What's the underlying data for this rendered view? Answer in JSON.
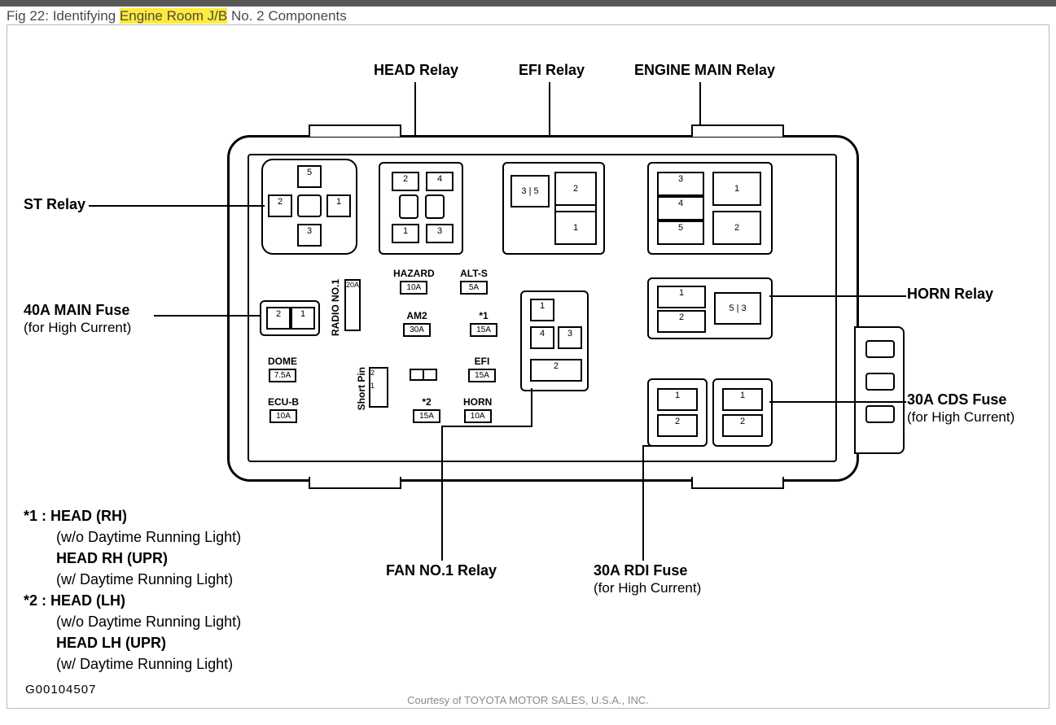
{
  "caption": {
    "prefix": "Fig 22: Identifying",
    "highlight": "Engine Room J/B",
    "suffix": "No. 2 Components"
  },
  "credit": "Courtesy of TOYOTA MOTOR SALES, U.S.A., INC.",
  "id_number": "G00104507",
  "labels": {
    "head_relay": "HEAD Relay",
    "efi_relay": "EFI Relay",
    "engine_main_relay": "ENGINE MAIN Relay",
    "st_relay": "ST Relay",
    "horn_relay": "HORN Relay",
    "main_fuse": "40A MAIN Fuse",
    "main_fuse_sub": "(for High Current)",
    "cds_fuse": "30A CDS Fuse",
    "cds_fuse_sub": "(for High Current)",
    "fan_relay": "FAN NO.1 Relay",
    "rdi_fuse": "30A RDI Fuse",
    "rdi_fuse_sub": "(for High Current)"
  },
  "fuses": {
    "hazard": {
      "name": "HAZARD",
      "amp": "10A"
    },
    "alts": {
      "name": "ALT-S",
      "amp": "5A"
    },
    "am2": {
      "name": "AM2",
      "amp": "30A"
    },
    "star1": {
      "name": "*1",
      "amp": "15A"
    },
    "dome": {
      "name": "DOME",
      "amp": "7.5A"
    },
    "efi": {
      "name": "EFI",
      "amp": "15A"
    },
    "ecub": {
      "name": "ECU-B",
      "amp": "10A"
    },
    "star2": {
      "name": "*2",
      "amp": "15A"
    },
    "horn": {
      "name": "HORN",
      "amp": "10A"
    },
    "radio": {
      "name": "RADIO NO.1",
      "amp": "20A"
    },
    "short": {
      "name": "Short Pin"
    }
  },
  "footnotes": {
    "s1_key": "*1 :",
    "s1_a": "HEAD (RH)",
    "s1_b": "(w/o Daytime Running Light)",
    "s1_c": "HEAD RH (UPR)",
    "s1_d": "(w/ Daytime Running Light)",
    "s2_key": "*2 :",
    "s2_a": "HEAD (LH)",
    "s2_b": "(w/o Daytime Running Light)",
    "s2_c": "HEAD LH (UPR)",
    "s2_d": "(w/ Daytime Running Light)"
  }
}
